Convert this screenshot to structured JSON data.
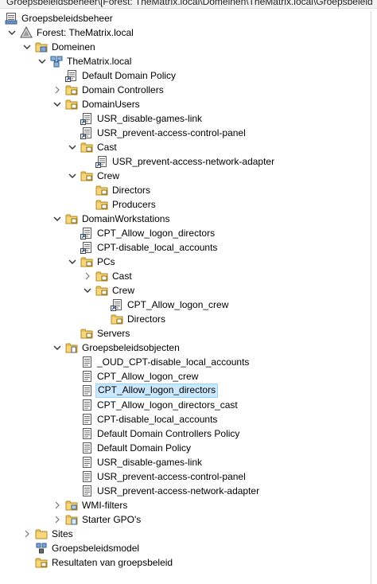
{
  "window": {
    "title": "Groepsbeleidsbeheer\\[Forest: TheMatrix.local\\Domeinen\\TheMatrix.local\\Groepsbeleid"
  },
  "tree": [
    {
      "label": "Groepsbeleidsbeheer",
      "icon": "gpmc-icon",
      "depth": 0,
      "expander": "none"
    },
    {
      "label": "Forest: TheMatrix.local",
      "icon": "forest-icon",
      "depth": 1,
      "expander": "expanded"
    },
    {
      "label": "Domeinen",
      "icon": "domains-folder-icon",
      "depth": 2,
      "expander": "expanded"
    },
    {
      "label": "TheMatrix.local",
      "icon": "domain-icon",
      "depth": 3,
      "expander": "expanded"
    },
    {
      "label": "Default Domain Policy",
      "icon": "gpo-link-icon",
      "depth": 4,
      "expander": "none"
    },
    {
      "label": "Domain Controllers",
      "icon": "ou-folder-icon",
      "depth": 4,
      "expander": "collapsed"
    },
    {
      "label": "DomainUsers",
      "icon": "ou-folder-icon",
      "depth": 4,
      "expander": "expanded"
    },
    {
      "label": "USR_disable-games-link",
      "icon": "gpo-link-icon",
      "depth": 5,
      "expander": "none"
    },
    {
      "label": "USR_prevent-access-control-panel",
      "icon": "gpo-link-icon",
      "depth": 5,
      "expander": "none"
    },
    {
      "label": "Cast",
      "icon": "ou-folder-icon",
      "depth": 5,
      "expander": "expanded"
    },
    {
      "label": "USR_prevent-access-network-adapter",
      "icon": "gpo-link-icon",
      "depth": 6,
      "expander": "none"
    },
    {
      "label": "Crew",
      "icon": "ou-folder-icon",
      "depth": 5,
      "expander": "expanded"
    },
    {
      "label": "Directors",
      "icon": "ou-folder-icon",
      "depth": 6,
      "expander": "none"
    },
    {
      "label": "Producers",
      "icon": "ou-folder-icon",
      "depth": 6,
      "expander": "none"
    },
    {
      "label": "DomainWorkstations",
      "icon": "ou-folder-icon",
      "depth": 4,
      "expander": "expanded"
    },
    {
      "label": "CPT_Allow_logon_directors",
      "icon": "gpo-link-icon",
      "depth": 5,
      "expander": "none"
    },
    {
      "label": "CPT-disable_local_accounts",
      "icon": "gpo-link-icon",
      "depth": 5,
      "expander": "none"
    },
    {
      "label": "PCs",
      "icon": "ou-folder-icon",
      "depth": 5,
      "expander": "expanded"
    },
    {
      "label": "Cast",
      "icon": "ou-folder-icon",
      "depth": 6,
      "expander": "collapsed"
    },
    {
      "label": "Crew",
      "icon": "ou-folder-icon",
      "depth": 6,
      "expander": "expanded"
    },
    {
      "label": "CPT_Allow_logon_crew",
      "icon": "gpo-link-icon",
      "depth": 7,
      "expander": "none"
    },
    {
      "label": "Directors",
      "icon": "ou-folder-icon",
      "depth": 7,
      "expander": "none"
    },
    {
      "label": "Servers",
      "icon": "ou-folder-icon",
      "depth": 5,
      "expander": "none"
    },
    {
      "label": "Groepsbeleidsobjecten",
      "icon": "gpo-container-icon",
      "depth": 4,
      "expander": "expanded"
    },
    {
      "label": "_OUD_CPT-disable_local_accounts",
      "icon": "gpo-icon",
      "depth": 5,
      "expander": "none"
    },
    {
      "label": "CPT_Allow_logon_crew",
      "icon": "gpo-icon",
      "depth": 5,
      "expander": "none"
    },
    {
      "label": "CPT_Allow_logon_directors",
      "icon": "gpo-icon",
      "depth": 5,
      "expander": "none",
      "selected": true
    },
    {
      "label": "CPT_Allow_logon_directors_cast",
      "icon": "gpo-icon",
      "depth": 5,
      "expander": "none"
    },
    {
      "label": "CPT-disable_local_accounts",
      "icon": "gpo-icon",
      "depth": 5,
      "expander": "none"
    },
    {
      "label": "Default Domain Controllers Policy",
      "icon": "gpo-icon",
      "depth": 5,
      "expander": "none"
    },
    {
      "label": "Default Domain Policy",
      "icon": "gpo-icon",
      "depth": 5,
      "expander": "none"
    },
    {
      "label": "USR_disable-games-link",
      "icon": "gpo-icon",
      "depth": 5,
      "expander": "none"
    },
    {
      "label": "USR_prevent-access-control-panel",
      "icon": "gpo-icon",
      "depth": 5,
      "expander": "none"
    },
    {
      "label": "USR_prevent-access-network-adapter",
      "icon": "gpo-icon",
      "depth": 5,
      "expander": "none"
    },
    {
      "label": "WMI-filters",
      "icon": "wmi-folder-icon",
      "depth": 4,
      "expander": "collapsed"
    },
    {
      "label": "Starter GPO's",
      "icon": "starter-gpo-folder-icon",
      "depth": 4,
      "expander": "collapsed"
    },
    {
      "label": "Sites",
      "icon": "sites-folder-icon",
      "depth": 2,
      "expander": "collapsed"
    },
    {
      "label": "Groepsbeleidsmodel",
      "icon": "gp-modeling-icon",
      "depth": 2,
      "expander": "none"
    },
    {
      "label": "Resultaten van groepsbeleid",
      "icon": "gp-results-folder-icon",
      "depth": 2,
      "expander": "none"
    }
  ],
  "colors": {
    "selection_bg": "#cce8ff",
    "selection_border": "#99d1ff",
    "folder_yellow": "#e8c25a",
    "folder_dark": "#c99a2e"
  }
}
